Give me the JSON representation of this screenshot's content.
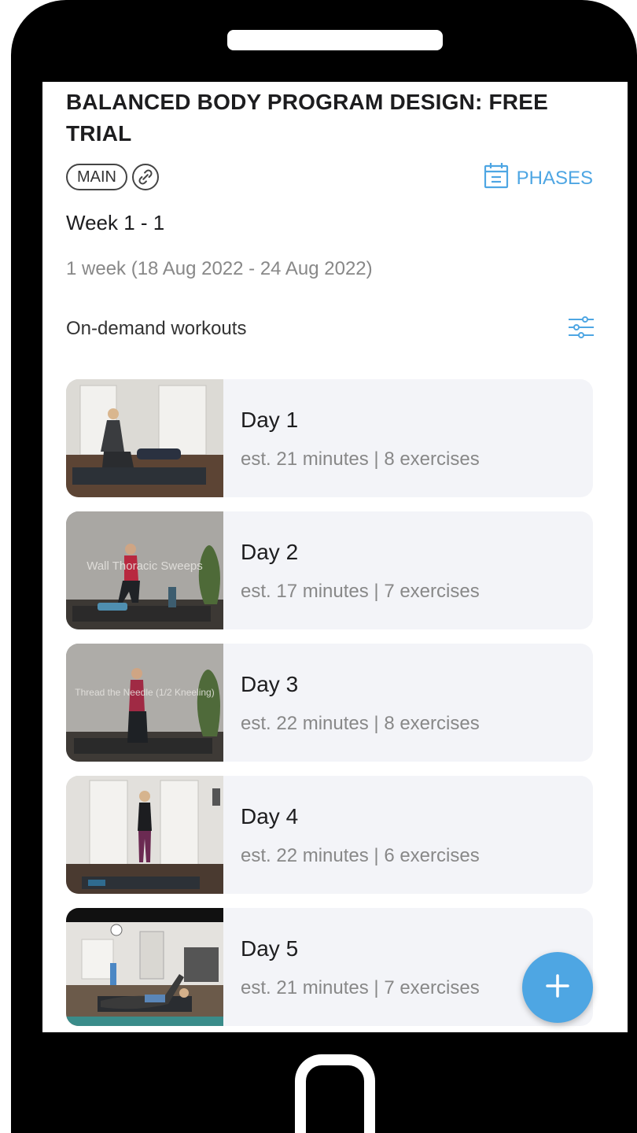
{
  "program": {
    "title": "BALANCED BODY PROGRAM DESIGN: FREE TRIAL",
    "tag": "MAIN",
    "phases_label": "PHASES"
  },
  "week": {
    "title": "Week 1 - 1",
    "range": "1 week (18 Aug 2022 - 24 Aug 2022)"
  },
  "section": {
    "label": "On-demand workouts"
  },
  "workouts": [
    {
      "day": "Day 1",
      "meta": "est. 21 minutes | 8 exercises"
    },
    {
      "day": "Day 2",
      "meta": "est. 17 minutes | 7 exercises",
      "overlay": "Wall Thoracic Sweeps"
    },
    {
      "day": "Day 3",
      "meta": "est. 22 minutes | 8 exercises",
      "overlay": "Thread the Needle (1/2 Kneeling)"
    },
    {
      "day": "Day 4",
      "meta": "est. 22 minutes | 6 exercises"
    },
    {
      "day": "Day 5",
      "meta": "est. 21 minutes | 7 exercises"
    }
  ],
  "colors": {
    "accent": "#4ea6e3",
    "card_bg": "#f3f4f8",
    "frame": "#000000"
  },
  "icons": {
    "tag_link": "link-icon",
    "phases": "calendar-icon",
    "filter": "sliders-icon",
    "fab": "plus-icon"
  }
}
